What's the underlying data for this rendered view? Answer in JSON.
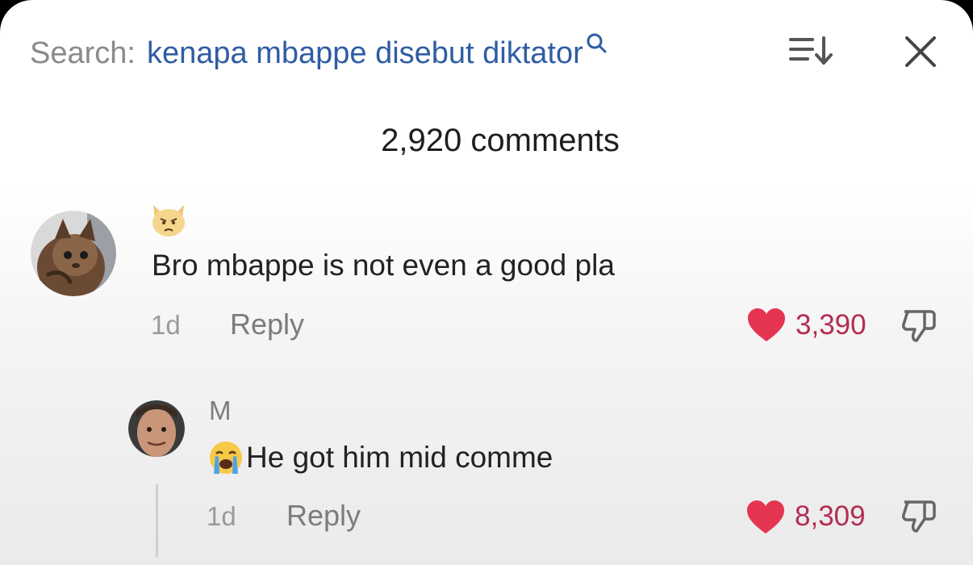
{
  "search": {
    "label": "Search:",
    "query": "kenapa mbappe disebut diktator"
  },
  "header": {
    "comment_count": "2,920 comments"
  },
  "icons": {
    "search": "search-icon",
    "sort": "sort-icon",
    "close": "close-icon",
    "like": "heart-icon",
    "dislike": "thumbs-down-icon"
  },
  "colors": {
    "query": "#2f5da3",
    "heart": "#e53553",
    "likes_text": "#b42c52"
  },
  "comments": [
    {
      "author": "",
      "emoji": "pouting-cat-emoji",
      "text": "Bro mbappe is not even a good pla",
      "time": "1d",
      "reply_label": "Reply",
      "likes": "3,390",
      "replies": [
        {
          "author": "M",
          "emoji": "loudly-crying-face-emoji",
          "text": "He got him mid comme",
          "time": "1d",
          "reply_label": "Reply",
          "likes": "8,309"
        }
      ]
    }
  ]
}
